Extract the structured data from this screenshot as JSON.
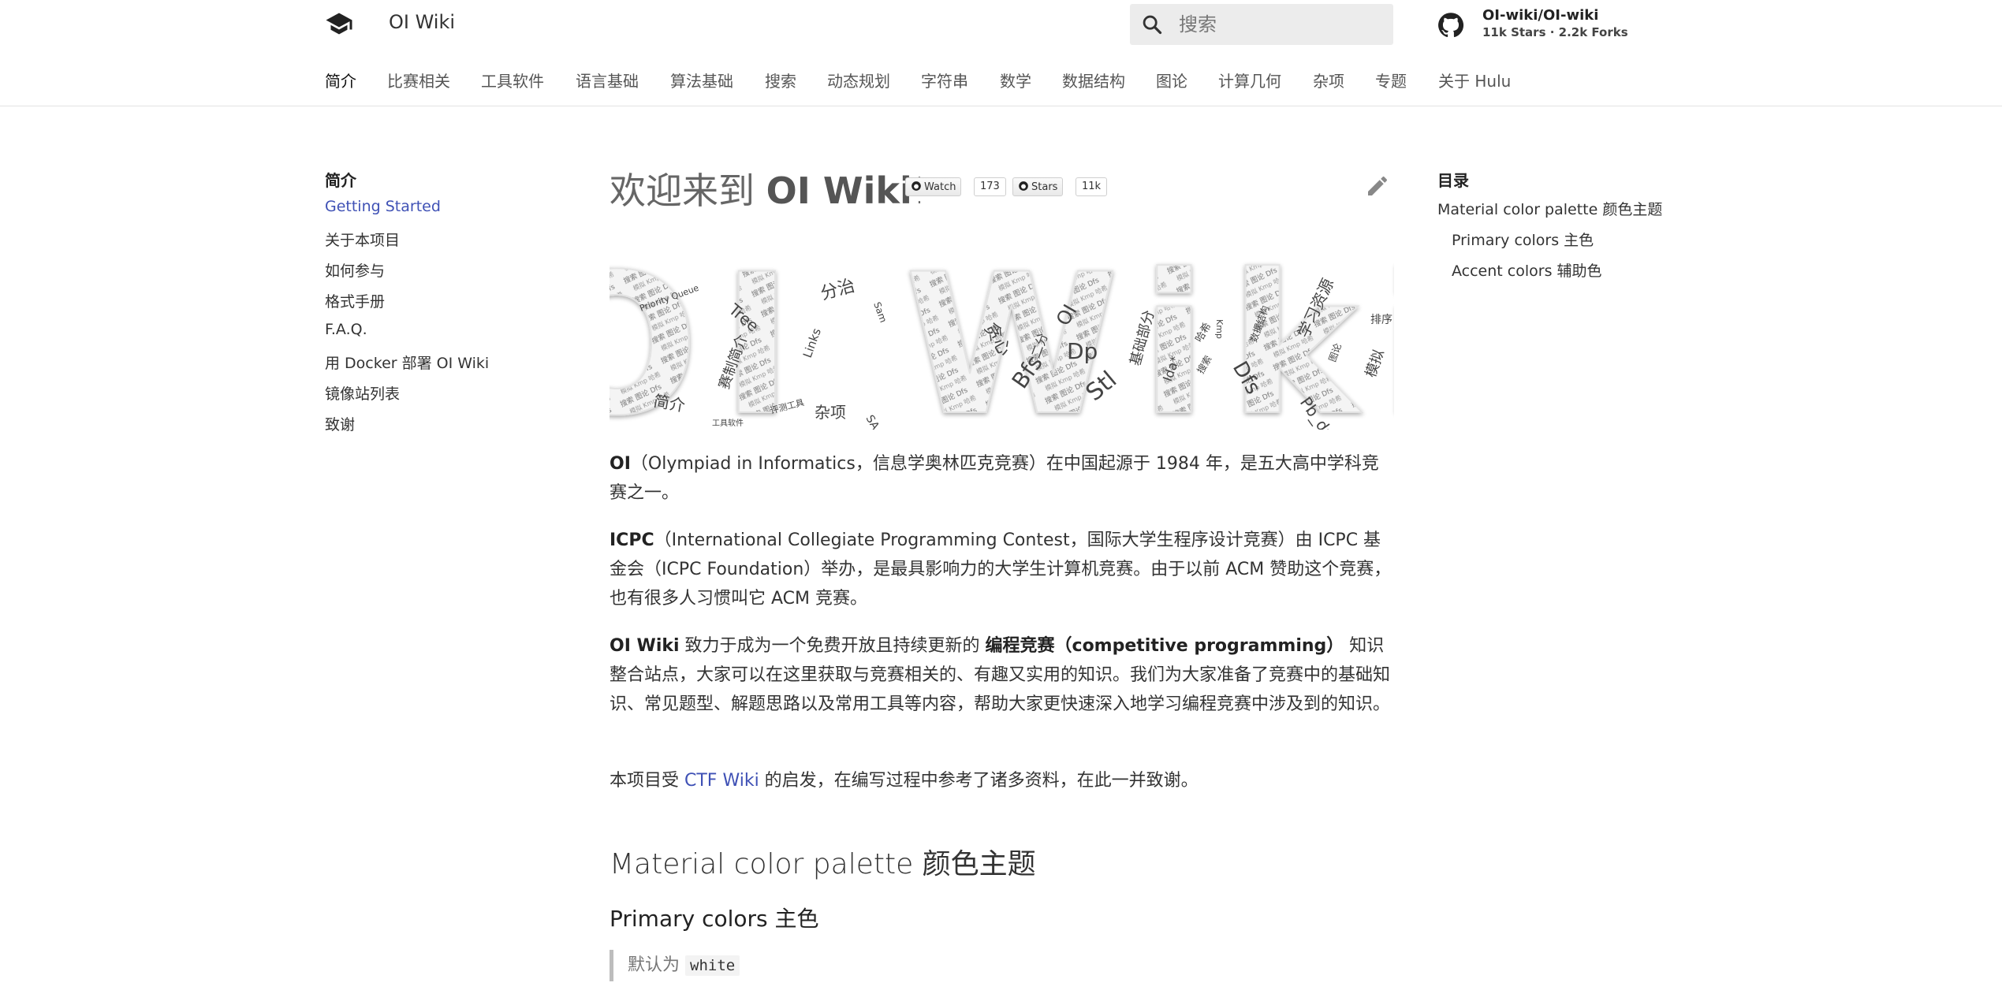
{
  "header": {
    "site_title": "OI Wiki",
    "search_placeholder": "搜索",
    "repo_name": "OI-wiki/OI-wiki",
    "repo_facts": "11k Stars · 2.2k Forks"
  },
  "tabs": [
    {
      "label": "简介",
      "active": true
    },
    {
      "label": "比赛相关"
    },
    {
      "label": "工具软件"
    },
    {
      "label": "语言基础"
    },
    {
      "label": "算法基础"
    },
    {
      "label": "搜索"
    },
    {
      "label": "动态规划"
    },
    {
      "label": "字符串"
    },
    {
      "label": "数学"
    },
    {
      "label": "数据结构"
    },
    {
      "label": "图论"
    },
    {
      "label": "计算几何"
    },
    {
      "label": "杂项"
    },
    {
      "label": "专题"
    },
    {
      "label": "关于 Hulu"
    }
  ],
  "sidebar": {
    "title": "简介",
    "items": [
      {
        "label": "Getting Started",
        "active": true
      },
      {
        "label": "关于本项目"
      },
      {
        "label": "如何参与"
      },
      {
        "label": "格式手册"
      },
      {
        "label": "F.A.Q."
      },
      {
        "label": "用 Docker 部署 OI Wiki"
      },
      {
        "label": "镜像站列表"
      },
      {
        "label": "致谢"
      }
    ]
  },
  "toc": {
    "title": "目录",
    "items": [
      {
        "label": "Material color palette 颜色主题"
      },
      {
        "label": "Primary colors 主色"
      },
      {
        "label": "Accent colors 辅助色"
      }
    ]
  },
  "main": {
    "heading_prefix": "欢迎来到",
    "heading_bold": "OI Wiki",
    "heading_suffix": "!",
    "badges": {
      "watch_label": "Watch",
      "watch_count": "173",
      "stars_label": "Stars",
      "stars_count": "11k"
    },
    "banner": {
      "big_text": "OI Wiki",
      "words": [
        "Priority Queue",
        "Tree",
        "分治",
        "Links",
        "Sam",
        "简介",
        "赛制简介",
        "杂项",
        "SA",
        "评测工具",
        "工具软件",
        "贪心",
        "OI",
        "Dp",
        "Bfs",
        "Stl",
        "二分",
        "基础部分",
        "Dfs",
        "Ida*",
        "Pb_ds",
        "学习资源",
        "模拟",
        "排序",
        "Kmp",
        "哈希",
        "搜索",
        "图论",
        "数据结构"
      ]
    },
    "p1_bold": "OI",
    "p1_text": "（Olympiad in Informatics，信息学奥林匹克竞赛）在中国起源于 1984 年，是五大高中学科竞赛之一。",
    "p2_bold": "ICPC",
    "p2_text": "（International Collegiate Programming Contest，国际大学生程序设计竞赛）由 ICPC 基金会（ICPC Foundation）举办，是最具影响力的大学生计算机竞赛。由于以前 ACM 赞助这个竞赛，也有很多人习惯叫它 ACM 竞赛。",
    "p3_bold": "OI Wiki",
    "p3_text_a": " 致力于成为一个免费开放且持续更新的 ",
    "p3_bold2": "编程竞赛（competitive programming）",
    "p3_text_b": " 知识整合站点，大家可以在这里获取与竞赛相关的、有趣又实用的知识。我们为大家准备了竞赛中的基础知识、常见题型、解题思路以及常用工具等内容，帮助大家更快速深入地学习编程竞赛中涉及到的知识。",
    "p4_text_a": "本项目受 ",
    "p4_link": "CTF Wiki",
    "p4_text_b": " 的启发，在编写过程中参考了诸多资料，在此一并致谢。",
    "h2": "Material color palette 颜色主题",
    "h3": "Primary colors 主色",
    "quote_text": "默认为 ",
    "quote_code": "white"
  },
  "colors": {
    "link": "#3f51b5",
    "text": "#333333",
    "search_bg": "#ececec"
  },
  "icons": [
    "graduation-cap-icon",
    "search-icon",
    "github-cat-icon",
    "edit-pencil-icon"
  ]
}
